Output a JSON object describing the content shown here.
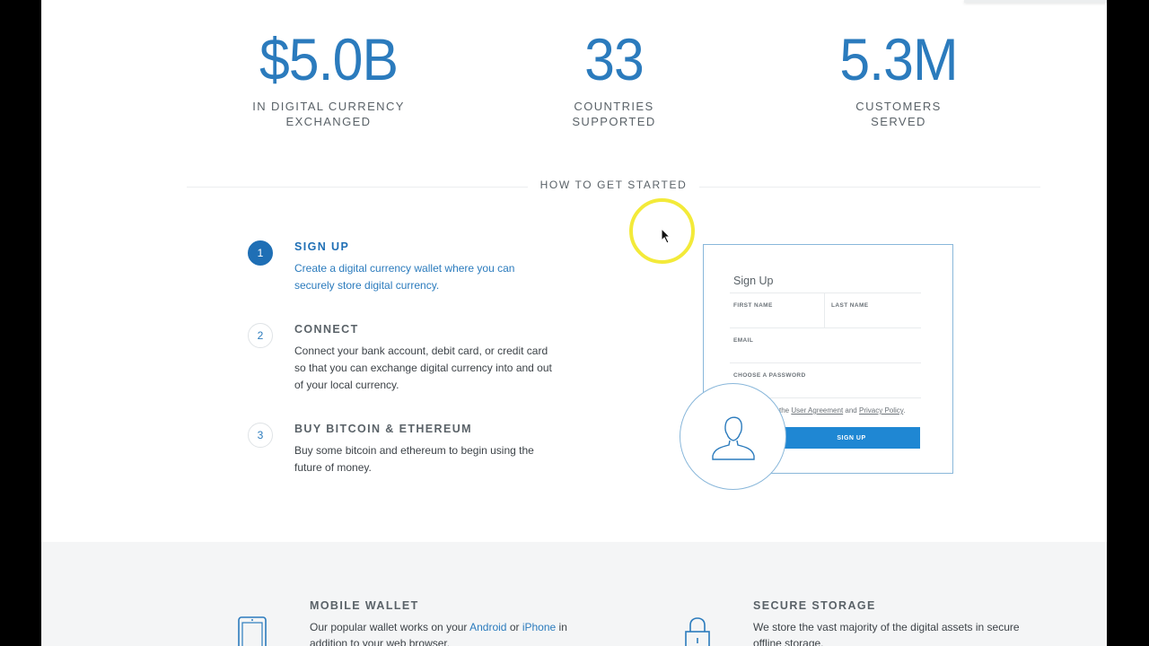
{
  "stats": [
    {
      "number": "$5.0B",
      "label_line1": "IN DIGITAL CURRENCY",
      "label_line2": "EXCHANGED"
    },
    {
      "number": "33",
      "label_line1": "COUNTRIES",
      "label_line2": "SUPPORTED"
    },
    {
      "number": "5.3M",
      "label_line1": "CUSTOMERS",
      "label_line2": "SERVED"
    }
  ],
  "section": {
    "title": "HOW TO GET STARTED"
  },
  "steps": [
    {
      "number": "1",
      "title": "SIGN UP",
      "description": "Create a digital currency wallet where you can securely store digital currency."
    },
    {
      "number": "2",
      "title": "CONNECT",
      "description": "Connect your bank account, debit card, or credit card so that you can exchange digital currency into and out of your local currency."
    },
    {
      "number": "3",
      "title": "BUY BITCOIN & ETHEREUM",
      "description": "Buy some bitcoin and ethereum to begin using the future of money."
    }
  ],
  "signup_card": {
    "title": "Sign Up",
    "first_name_label": "FIRST NAME",
    "last_name_label": "LAST NAME",
    "email_label": "EMAIL",
    "password_label": "CHOOSE A PASSWORD",
    "agree_prefix": "the",
    "user_agreement": "User Agreement",
    "agree_and": "and",
    "privacy_policy": "Privacy Policy",
    "agree_suffix": ".",
    "button": "SIGN UP"
  },
  "features": {
    "mobile": {
      "title": "MOBILE WALLET",
      "desc_part1": "Our popular wallet works on your",
      "link_android": "Android",
      "desc_or": "or",
      "link_iphone": "iPhone",
      "desc_part2": "in addition to your web browser."
    },
    "secure": {
      "title": "SECURE STORAGE",
      "desc": "We store the vast majority of the digital assets in secure offline storage."
    }
  },
  "colors": {
    "accent": "#1f6fb5",
    "link": "#2b7bbd",
    "button": "#1f87d3",
    "cursor_ring": "#f3ea39"
  }
}
